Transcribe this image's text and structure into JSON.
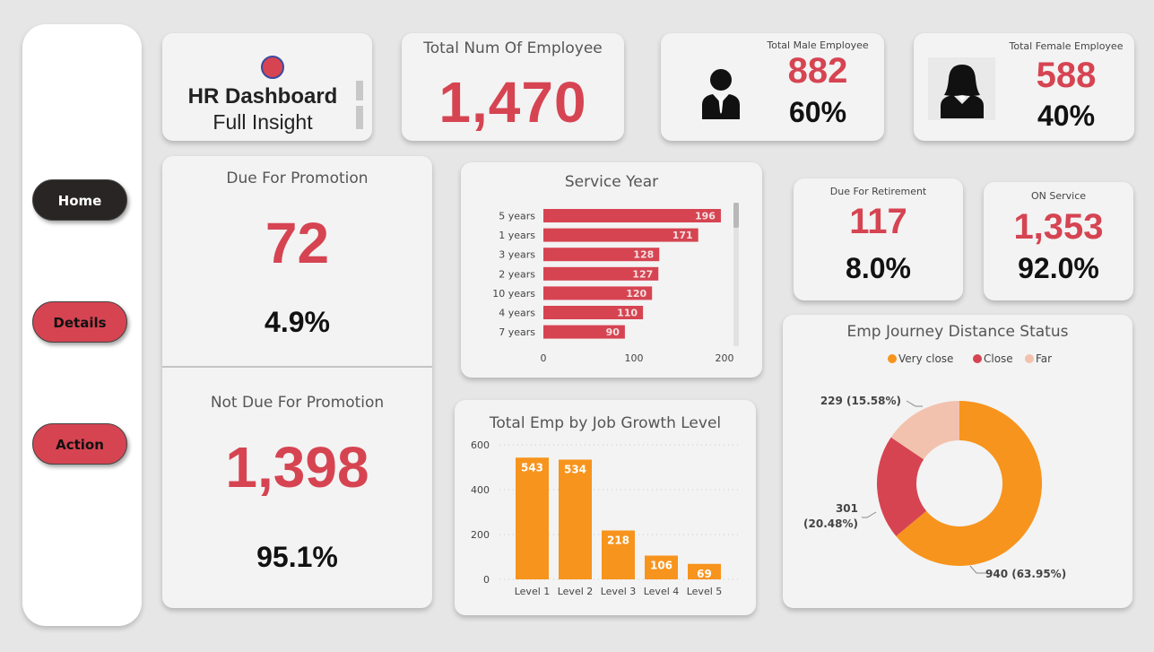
{
  "sidebar": {
    "home_label": "Home",
    "details_label": "Details",
    "action_label": "Action"
  },
  "header": {
    "title": "HR Dashboard",
    "subtitle": "Full Insight"
  },
  "total_employee": {
    "title": "Total Num Of Employee",
    "value": "1,470"
  },
  "male": {
    "title": "Total Male Employee",
    "value": "882",
    "percent": "60%"
  },
  "female": {
    "title": "Total Female Employee",
    "value": "588",
    "percent": "40%"
  },
  "promotion": {
    "due_title": "Due For Promotion",
    "due_value": "72",
    "due_percent": "4.9%",
    "not_due_title": "Not Due For Promotion",
    "not_due_value": "1,398",
    "not_due_percent": "95.1%"
  },
  "retirement": {
    "title": "Due For Retirement",
    "value": "117",
    "percent": "8.0%"
  },
  "on_service": {
    "title": "ON Service",
    "value": "1,353",
    "percent": "92.0%"
  },
  "colors": {
    "red": "#d64452",
    "orange": "#f7941d",
    "peach": "#f2c2ae",
    "dark": "#2a2525"
  },
  "chart_data": [
    {
      "type": "bar",
      "orientation": "horizontal",
      "title": "Service Year",
      "categories": [
        "5 years",
        "1 years",
        "3 years",
        "2 years",
        "10 years",
        "4 years",
        "7 years"
      ],
      "values": [
        196,
        171,
        128,
        127,
        120,
        110,
        90
      ],
      "xlim": [
        0,
        200
      ],
      "xticks": [
        "0",
        "100",
        "200"
      ],
      "color": "#d64452"
    },
    {
      "type": "bar",
      "title": "Total Emp by Job Growth Level",
      "categories": [
        "Level 1",
        "Level 2",
        "Level 3",
        "Level 4",
        "Level 5"
      ],
      "values": [
        543,
        534,
        218,
        106,
        69
      ],
      "ylim": [
        0,
        600
      ],
      "yticks": [
        "0",
        "200",
        "400",
        "600"
      ],
      "color": "#f7941d"
    },
    {
      "type": "pie",
      "donut": true,
      "title": "Emp Journey Distance Status",
      "legend_position": "top",
      "slices": [
        {
          "name": "Very close",
          "value": 940,
          "label": "940 (63.95%)",
          "color": "#f7941d"
        },
        {
          "name": "Close",
          "value": 301,
          "label_line1": "301",
          "label_line2": "(20.48%)",
          "color": "#d64452"
        },
        {
          "name": "Far",
          "value": 229,
          "label": "229 (15.58%)",
          "color": "#f2c2ae"
        }
      ]
    }
  ]
}
